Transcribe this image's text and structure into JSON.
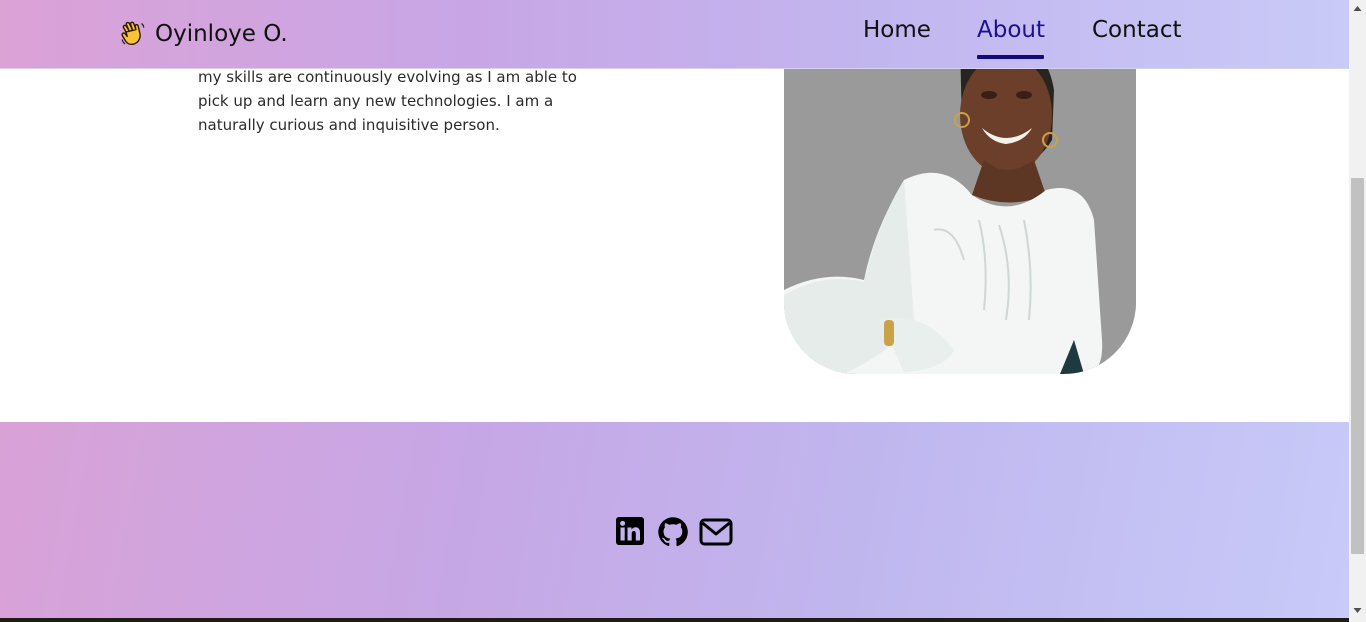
{
  "navbar": {
    "brand_emoji_icon": "waving-hand-icon",
    "brand_name": "Oyinloye O.",
    "links": [
      {
        "label": "Home",
        "active": false
      },
      {
        "label": "About",
        "active": true
      },
      {
        "label": "Contact",
        "active": false
      }
    ]
  },
  "about": {
    "paragraph": "my skills are continuously evolving as I am able to pick up and learn any new technologies. I am a naturally curious and inquisitive person."
  },
  "footer": {
    "social_icons": [
      "linkedin-icon",
      "github-icon",
      "mail-icon"
    ]
  },
  "colors": {
    "active_link": "#1b0f96",
    "underline": "#14087e",
    "gradient_start": "#dba2d6",
    "gradient_end": "#c9caf7"
  }
}
